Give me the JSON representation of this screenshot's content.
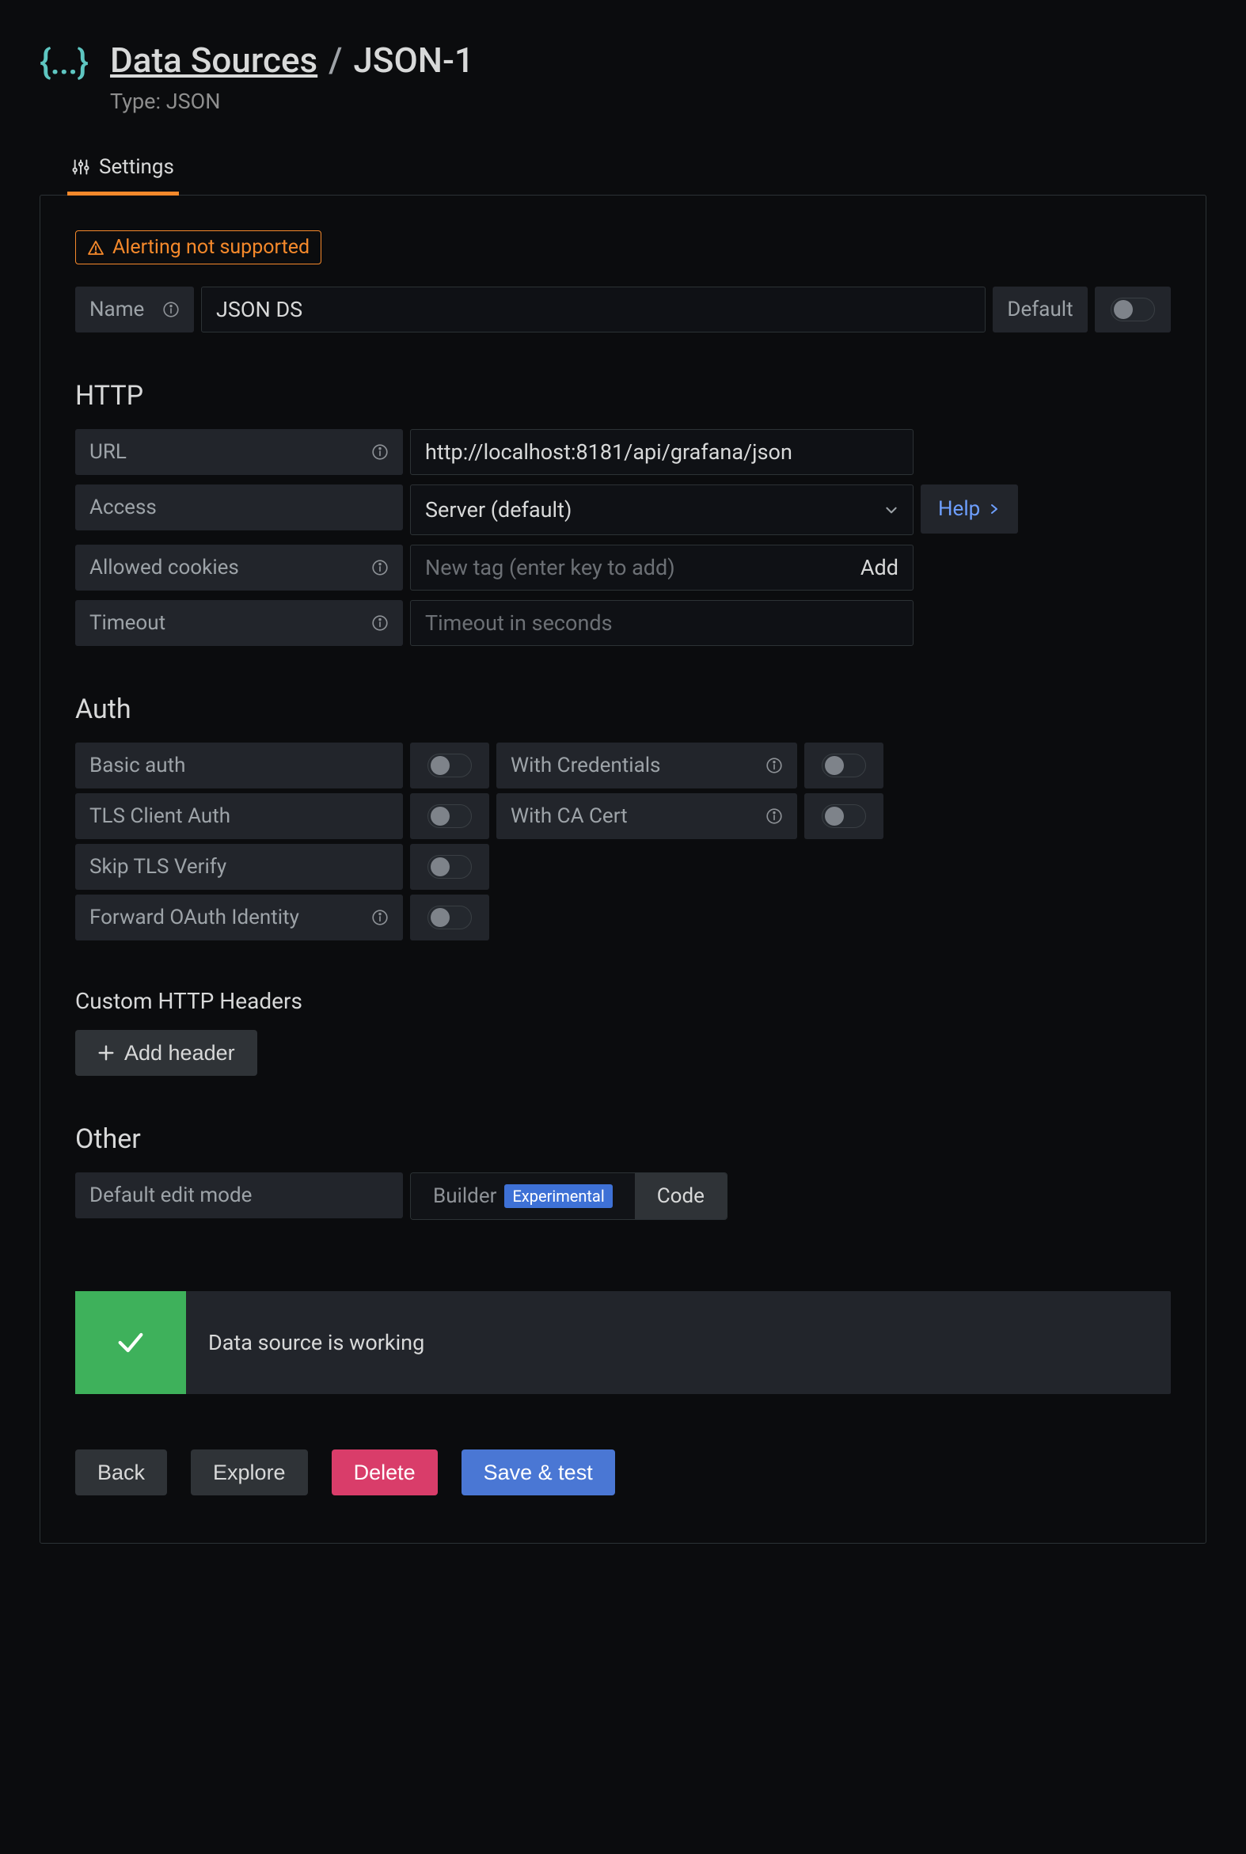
{
  "header": {
    "breadcrumb_root": "Data Sources",
    "breadcrumb_current": "JSON-1",
    "type_prefix": "Type:",
    "type_value": "JSON"
  },
  "tabs": {
    "settings": "Settings"
  },
  "alert_badge": "Alerting not supported",
  "name": {
    "label": "Name",
    "value": "JSON DS",
    "default_label": "Default"
  },
  "http": {
    "heading": "HTTP",
    "url_label": "URL",
    "url_value": "http://localhost:8181/api/grafana/json",
    "access_label": "Access",
    "access_value": "Server (default)",
    "help_label": "Help",
    "cookies_label": "Allowed cookies",
    "cookies_placeholder": "New tag (enter key to add)",
    "cookies_add": "Add",
    "timeout_label": "Timeout",
    "timeout_placeholder": "Timeout in seconds"
  },
  "auth": {
    "heading": "Auth",
    "basic": "Basic auth",
    "with_credentials": "With Credentials",
    "tls_client": "TLS Client Auth",
    "with_ca": "With CA Cert",
    "skip_tls": "Skip TLS Verify",
    "forward_oauth": "Forward OAuth Identity"
  },
  "custom_headers": {
    "heading": "Custom HTTP Headers",
    "add_label": "Add header"
  },
  "other": {
    "heading": "Other",
    "default_edit_mode": "Default edit mode",
    "builder": "Builder",
    "experimental": "Experimental",
    "code": "Code"
  },
  "status": {
    "message": "Data source is working"
  },
  "buttons": {
    "back": "Back",
    "explore": "Explore",
    "delete": "Delete",
    "save": "Save & test"
  }
}
